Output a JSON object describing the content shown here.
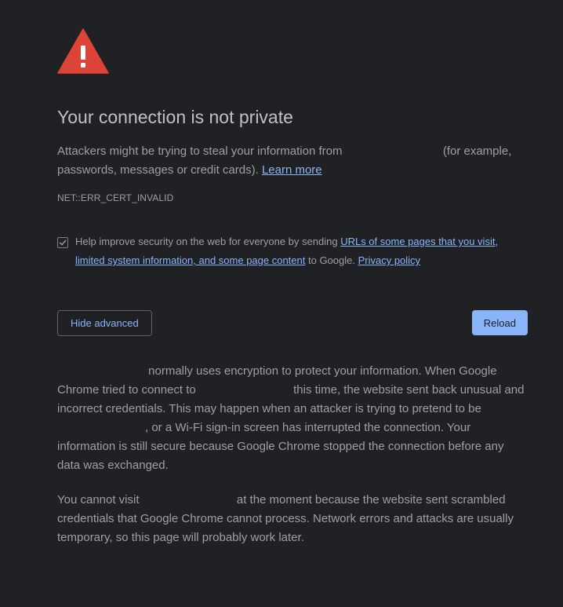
{
  "interstitial": {
    "icon": "warning-triangle-icon",
    "icon_color": "#db4437",
    "title": "Your connection is not private",
    "intro_before": "Attackers might be trying to steal your information from ",
    "intro_after": " (for example, passwords, messages or credit cards).",
    "learn_more": "Learn more",
    "error_code": "NET::ERR_CERT_INVALID"
  },
  "optin": {
    "checked": true,
    "text_before": "Help improve security on the web for everyone by sending ",
    "link_text": "URLs of some pages that you visit, limited system information, and some page content",
    "text_middle": " to Google. ",
    "privacy_link": "Privacy policy"
  },
  "buttons": {
    "hide_advanced": "Hide advanced",
    "reload": "Reload"
  },
  "details": {
    "p1_a": " normally uses encryption to protect your information. When Google Chrome tried to connect to ",
    "p1_b": " this time, the website sent back unusual and incorrect credentials. This may happen when an attacker is trying to pretend to be ",
    "p1_c": ", or a Wi-Fi sign-in screen has interrupted the connection. Your information is still secure because Google Chrome stopped the connection before any data was exchanged.",
    "p2_a": "You cannot visit ",
    "p2_b": " at the moment because the website sent scrambled credentials that Google Chrome cannot process. Network errors and attacks are usually temporary, so this page will probably work later."
  },
  "colors": {
    "background": "#202124",
    "text": "#9aa0a6",
    "title": "#bdc1c6",
    "link": "#8ab4f8",
    "primary_button": "#8ab4f8"
  }
}
